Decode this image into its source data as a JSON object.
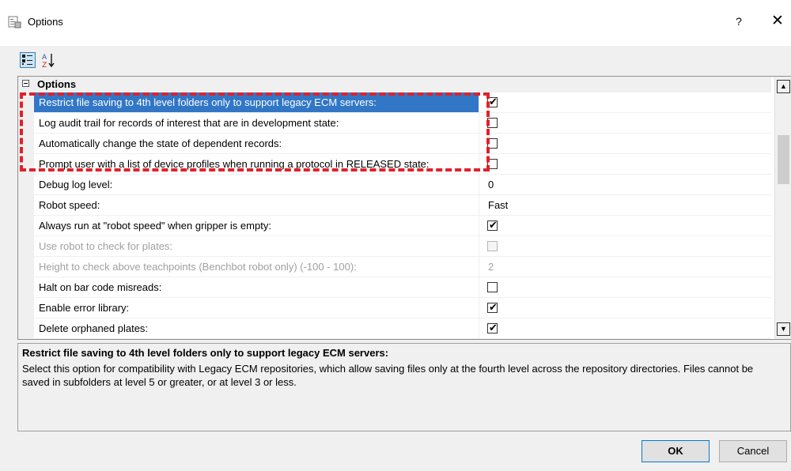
{
  "window": {
    "title": "Options",
    "help_glyph": "?",
    "close_glyph": "✕"
  },
  "toolbar": {
    "categorized_icon": "categorized-icon",
    "alphabetical_icon": "sort-az-icon"
  },
  "grid": {
    "category": "Options",
    "rows": [
      {
        "name": "Restrict file saving to 4th level folders only to support legacy ECM servers:",
        "type": "checkbox",
        "checked": true,
        "selected": true,
        "disabled": false
      },
      {
        "name": "Log audit trail for records of interest that are in development state:",
        "type": "checkbox",
        "checked": false,
        "selected": false,
        "disabled": false
      },
      {
        "name": "Automatically change the state of dependent records:",
        "type": "checkbox",
        "checked": false,
        "selected": false,
        "disabled": false
      },
      {
        "name": "Prompt user with a list of device profiles when running a protocol in RELEASED state:",
        "type": "checkbox",
        "checked": false,
        "selected": false,
        "disabled": false
      },
      {
        "name": "Debug log level:",
        "type": "text",
        "value": "0",
        "selected": false,
        "disabled": false
      },
      {
        "name": "Robot speed:",
        "type": "text",
        "value": "Fast",
        "selected": false,
        "disabled": false
      },
      {
        "name": "Always run at \"robot speed\" when gripper is empty:",
        "type": "checkbox",
        "checked": true,
        "selected": false,
        "disabled": false
      },
      {
        "name": "Use robot to check for plates:",
        "type": "checkbox",
        "checked": false,
        "selected": false,
        "disabled": true
      },
      {
        "name": "Height to check above teachpoints (Benchbot robot only) (-100 - 100):",
        "type": "text",
        "value": "2",
        "selected": false,
        "disabled": true
      },
      {
        "name": "Halt on bar code misreads:",
        "type": "checkbox",
        "checked": false,
        "selected": false,
        "disabled": false
      },
      {
        "name": "Enable error library:",
        "type": "checkbox",
        "checked": true,
        "selected": false,
        "disabled": false
      },
      {
        "name": "Delete orphaned plates:",
        "type": "checkbox",
        "checked": true,
        "selected": false,
        "disabled": false
      }
    ],
    "check_glyph": "✔",
    "highlight_color": "#e0212a",
    "selection_color": "#3276c6"
  },
  "description": {
    "title": "Restrict file saving to 4th level folders only to support legacy ECM servers:",
    "body": "Select this option for compatibility with Legacy ECM repositories, which allow saving files only at the fourth level across the repository directories.  Files cannot be saved in subfolders at level 5 or greater, or at level 3 or less."
  },
  "buttons": {
    "ok": "OK",
    "cancel": "Cancel"
  }
}
